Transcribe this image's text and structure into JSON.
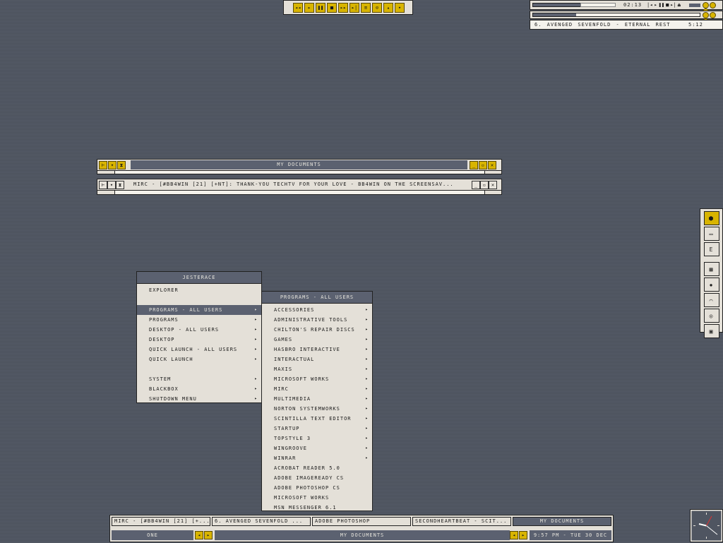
{
  "media_controls": {
    "icons": [
      "rewind-icon",
      "play-icon",
      "pause-icon",
      "stop-icon",
      "fast-forward-icon",
      "skip-end-icon",
      "playlist-icon",
      "eject-icon",
      "up-icon",
      "down-icon"
    ],
    "glyphs": [
      "◂◂",
      "▸",
      "❚❚",
      "■",
      "▸▸",
      "▸|",
      "≡",
      "⊙",
      "▴",
      "▾"
    ]
  },
  "winamp": {
    "time": "02:13",
    "controls": [
      "|◂",
      "▸",
      "❚❚",
      "■",
      "▸|",
      "⏏"
    ],
    "song_label": "6. AVENGED SEVENFOLD - ETERNAL REST",
    "song_length": "5:12",
    "progress": 0.26
  },
  "windows": [
    {
      "title": "MY DOCUMENTS"
    },
    {
      "title": "MIRC - [#BB4WIN [21] [+NT]: THANK-YOU TECHTV FOR YOUR LOVE - BB4WIN ON THE SCREENSAV..."
    }
  ],
  "root_menu": {
    "title": "JESTERACE",
    "items": [
      {
        "label": "EXPLORER",
        "submenu": false
      },
      {
        "label": "",
        "submenu": false,
        "gap": true
      },
      {
        "label": "PROGRAMS - ALL USERS",
        "submenu": true,
        "selected": true
      },
      {
        "label": "PROGRAMS",
        "submenu": true
      },
      {
        "label": "DESKTOP - ALL USERS",
        "submenu": true
      },
      {
        "label": "DESKTOP",
        "submenu": true
      },
      {
        "label": "QUICK LAUNCH - ALL USERS",
        "submenu": true
      },
      {
        "label": "QUICK LAUNCH",
        "submenu": true
      },
      {
        "label": "",
        "submenu": false,
        "gap": true
      },
      {
        "label": "SYSTEM",
        "submenu": true
      },
      {
        "label": "BLACKBOX",
        "submenu": true
      },
      {
        "label": "SHUTDOWN MENU",
        "submenu": true
      }
    ]
  },
  "programs_menu": {
    "title": "PROGRAMS - ALL USERS",
    "items": [
      {
        "label": "ACCESSORIES",
        "submenu": true
      },
      {
        "label": "ADMINISTRATIVE TOOLS",
        "submenu": true
      },
      {
        "label": "CHILTON'S REPAIR DISCS",
        "submenu": true
      },
      {
        "label": "GAMES",
        "submenu": true
      },
      {
        "label": "HASBRO INTERACTIVE",
        "submenu": true
      },
      {
        "label": "INTERACTUAL",
        "submenu": true
      },
      {
        "label": "MAXIS",
        "submenu": true
      },
      {
        "label": "MICROSOFT WORKS",
        "submenu": true
      },
      {
        "label": "MIRC",
        "submenu": true
      },
      {
        "label": "MULTIMEDIA",
        "submenu": true
      },
      {
        "label": "NORTON SYSTEMWORKS",
        "submenu": true
      },
      {
        "label": "SCINTILLA TEXT EDITOR",
        "submenu": true
      },
      {
        "label": "STARTUP",
        "submenu": true
      },
      {
        "label": "TOPSTYLE 3",
        "submenu": true
      },
      {
        "label": "WINGROOVE",
        "submenu": true
      },
      {
        "label": "WINRAR",
        "submenu": true
      },
      {
        "label": "ACROBAT READER 5.0",
        "submenu": false
      },
      {
        "label": "ADOBE IMAGEREADY CS",
        "submenu": false
      },
      {
        "label": "ADOBE PHOTOSHOP CS",
        "submenu": false
      },
      {
        "label": "MICROSOFT WORKS",
        "submenu": false
      },
      {
        "label": "MSN MESSENGER 6.1",
        "submenu": false
      }
    ]
  },
  "taskbar": {
    "tasks": [
      {
        "label": "MIRC - [#BB4WIN [21] [+...",
        "active": false
      },
      {
        "label": "6. AVENGED SEVENFOLD ...",
        "active": false
      },
      {
        "label": "ADOBE PHOTOSHOP",
        "active": false
      },
      {
        "label": "SECONDHEARTBEAT - SCIT...",
        "active": false
      },
      {
        "label": "MY DOCUMENTS",
        "active": true
      }
    ],
    "workspace": "ONE",
    "window_label": "MY DOCUMENTS",
    "clock": "9:57 PM - TUE 30 DEC"
  },
  "slit": {
    "icons": [
      "hex-icon",
      "window-icon",
      "e-icon",
      "network-icon",
      "gear-icon",
      "mouse-icon",
      "disc-icon",
      "monitor-icon"
    ],
    "glyphs": [
      "⬢",
      "▭",
      "E",
      "▦",
      "✹",
      "⌒",
      "◎",
      "▣"
    ]
  },
  "colors": {
    "accent": "#d8b400",
    "panel_dark": "#5b6170",
    "panel_light": "#e4e0d8"
  }
}
